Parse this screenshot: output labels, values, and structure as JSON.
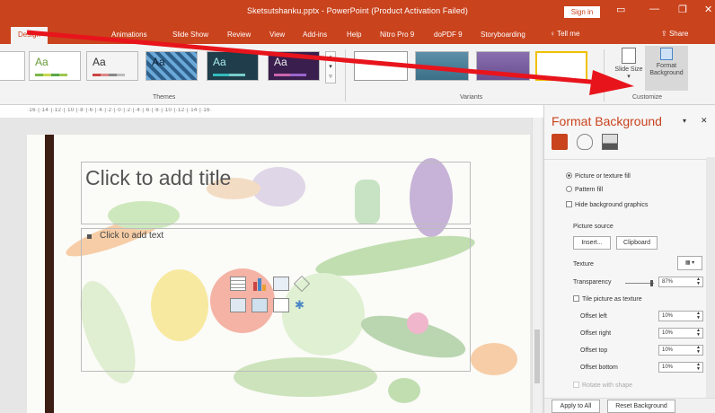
{
  "titlebar": {
    "doc_title": "Sketsutshanku.pptx - PowerPoint (Product Activation Failed)",
    "signin": "Sign in",
    "icons": [
      "ribbon-display-icon",
      "minimize-icon",
      "restore-icon",
      "close-icon"
    ]
  },
  "tabs": [
    {
      "label": "Design",
      "active": true
    },
    {
      "label": "Animations"
    },
    {
      "label": "Slide Show"
    },
    {
      "label": "Review"
    },
    {
      "label": "View"
    },
    {
      "label": "Add-ins"
    },
    {
      "label": "Help"
    },
    {
      "label": "Nitro Pro 9"
    },
    {
      "label": "doPDF 9"
    },
    {
      "label": "Storyboarding"
    }
  ],
  "tellme": "Tell me",
  "share": "Share",
  "ribbon": {
    "themes_label": "Themes",
    "variants_label": "Variants",
    "customize_label": "Customize",
    "theme_thumb_text": "Aa",
    "slide_size": "Slide Size",
    "format_background": "Format Background"
  },
  "ruler_text": "·16·|·14·|·12·|·10·|·8·|·6·|·4·|·2·|·0·|·2·|·4·|·6·|·8·|·10·|·12·|·14·|·16·",
  "slide": {
    "title_placeholder": "Click to add title",
    "body_placeholder": "Click to add text"
  },
  "pane": {
    "title": "Format Background",
    "fill_options": [
      {
        "label": "Picture or texture fill",
        "checked": true
      },
      {
        "label": "Pattern fill",
        "checked": false
      }
    ],
    "hide_bg": "Hide background graphics",
    "picture_source": "Picture source",
    "insert_btn": "Insert...",
    "clipboard_btn": "Clipboard",
    "texture": "Texture",
    "transparency": "Transparency",
    "transparency_value": "87%",
    "tile": "Tile picture as texture",
    "offsets": [
      {
        "label": "Offset left",
        "value": "10%"
      },
      {
        "label": "Offset right",
        "value": "10%"
      },
      {
        "label": "Offset top",
        "value": "10%"
      },
      {
        "label": "Offset bottom",
        "value": "10%"
      }
    ],
    "rotate": "Rotate with shape",
    "apply_all": "Apply to All",
    "reset_bg": "Reset Background"
  },
  "colors": {
    "accent": "#c9431d",
    "arrow": "#e8141c"
  }
}
